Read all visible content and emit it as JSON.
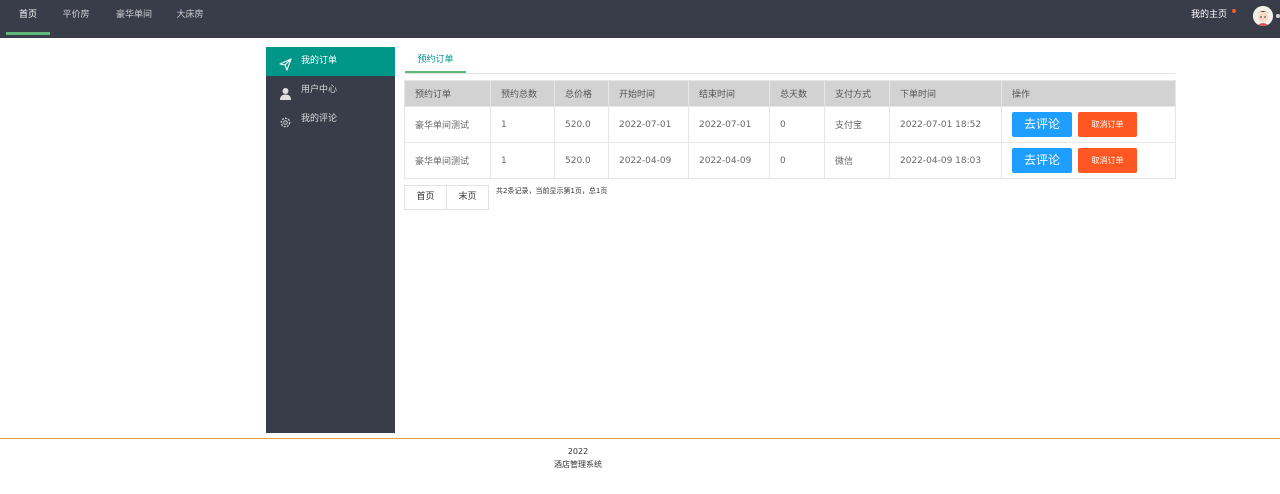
{
  "nav": {
    "items": [
      {
        "label": "首页"
      },
      {
        "label": "平价房"
      },
      {
        "label": "豪华单间"
      },
      {
        "label": "大床房"
      }
    ],
    "my_home_label": "我的主页"
  },
  "sidebar": {
    "items": [
      {
        "label": "我的订单",
        "icon": "send-icon"
      },
      {
        "label": "用户中心",
        "icon": "user-icon"
      },
      {
        "label": "我的评论",
        "icon": "gear-icon"
      }
    ]
  },
  "tabs": [
    {
      "label": "预约订单"
    }
  ],
  "table": {
    "headers": [
      "预约订单",
      "预约总数",
      "总价格",
      "开始时间",
      "结束时间",
      "总天数",
      "支付方式",
      "下单时间",
      "操作"
    ],
    "rows": [
      {
        "name": "豪华单间测试",
        "count": "1",
        "price": "520.0",
        "start": "2022-07-01",
        "end": "2022-07-01",
        "days": "0",
        "payment": "支付宝",
        "ordered_at": "2022-07-01 18:52",
        "review_label": "去评论",
        "cancel_label": "取消订单"
      },
      {
        "name": "豪华单间测试",
        "count": "1",
        "price": "520.0",
        "start": "2022-04-09",
        "end": "2022-04-09",
        "days": "0",
        "payment": "微信",
        "ordered_at": "2022-04-09 18:03",
        "review_label": "去评论",
        "cancel_label": "取消订单"
      }
    ]
  },
  "pager": {
    "first_label": "首页",
    "last_label": "末页",
    "info": "共2条记录，当前显示第1页，总1页"
  },
  "footer": {
    "year": "2022",
    "name": "酒店管理系统"
  },
  "colors": {
    "nav_bg": "#393d49",
    "active": "#009688",
    "review_button": "#1e9fff",
    "cancel_button": "#ff5722",
    "footer_line": "#e6a23c"
  }
}
